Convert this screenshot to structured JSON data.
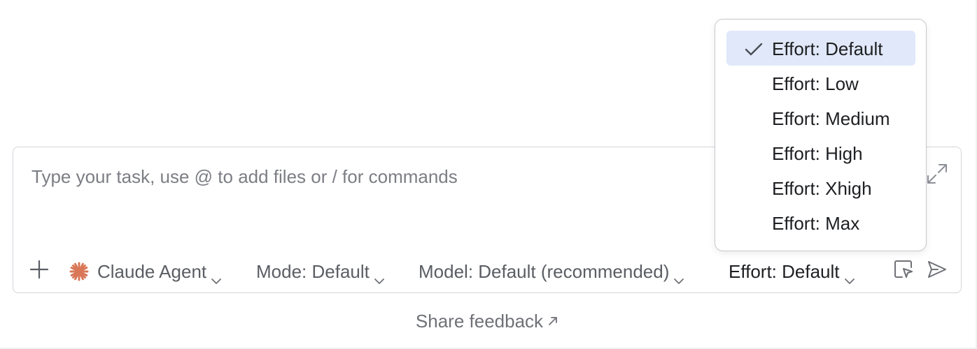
{
  "input": {
    "placeholder": "Type your task, use @ to add files or / for commands",
    "value": ""
  },
  "toolbar": {
    "add_icon": "plus-icon",
    "agent_label": "Claude Agent",
    "agent_icon": "claude-spark-icon",
    "mode_label": "Mode: Default",
    "model_label": "Model: Default (recommended)",
    "effort_label": "Effort: Default",
    "pointer_icon": "select-element-icon",
    "send_icon": "send-icon",
    "expand_icon": "expand-icon"
  },
  "effort_menu": {
    "items": [
      {
        "label": "Effort: Default",
        "selected": true
      },
      {
        "label": "Effort: Low",
        "selected": false
      },
      {
        "label": "Effort: Medium",
        "selected": false
      },
      {
        "label": "Effort: High",
        "selected": false
      },
      {
        "label": "Effort: Xhigh",
        "selected": false
      },
      {
        "label": "Effort: Max",
        "selected": false
      }
    ]
  },
  "footer": {
    "share_feedback": "Share feedback",
    "share_icon": "external-link-arrow-icon"
  },
  "colors": {
    "accent_selected_bg": "#e0e8f9",
    "claude_orange": "#d97757",
    "border": "#d3d5db",
    "muted_text": "#5a5d63"
  }
}
